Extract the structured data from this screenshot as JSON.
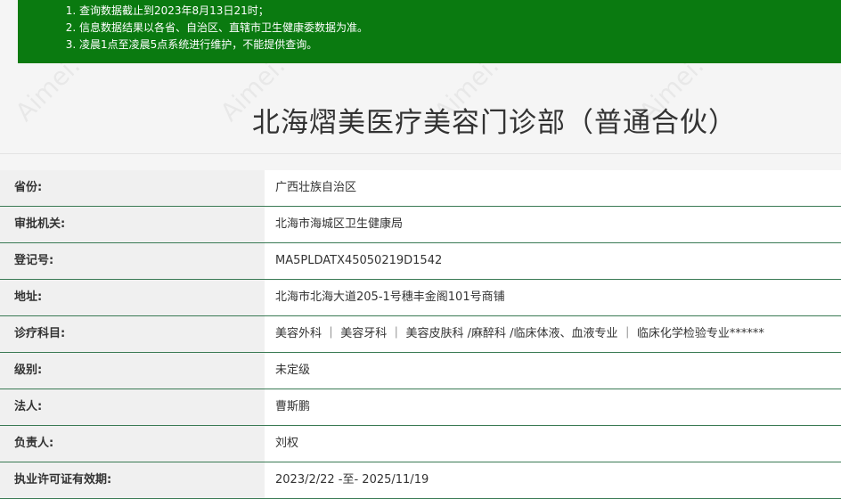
{
  "notice": {
    "items": [
      "查询数据截止到2023年8月13日21时；",
      "信息数据结果以各省、自治区、直辖市卫生健康委数据为准。",
      "凌晨1点至凌晨5点系统进行维护，不能提供查询。"
    ],
    "background": "#0a7a10"
  },
  "title": "北海熠美医疗美容门诊部（普通合伙）",
  "watermark_text": "Aimei.COM",
  "rows": [
    {
      "label": "省份:",
      "value": "广西壮族自治区"
    },
    {
      "label": "审批机关:",
      "value": "北海市海城区卫生健康局"
    },
    {
      "label": "登记号:",
      "value": "MA5PLDATX45050219D1542"
    },
    {
      "label": "地址:",
      "value": "北海市北海大道205-1号穗丰金阁101号商铺"
    },
    {
      "label": "诊疗科目:",
      "value": "美容外科 ｜ 美容牙科 ｜ 美容皮肤科 /麻醉科 /临床体液、血液专业 ｜ 临床化学检验专业******"
    },
    {
      "label": "级别:",
      "value": "未定级"
    },
    {
      "label": "法人:",
      "value": "曹斯鹏"
    },
    {
      "label": "负责人:",
      "value": "刘权"
    },
    {
      "label": "执业许可证有效期:",
      "value": "2023/2/22 -至- 2025/11/19"
    }
  ]
}
